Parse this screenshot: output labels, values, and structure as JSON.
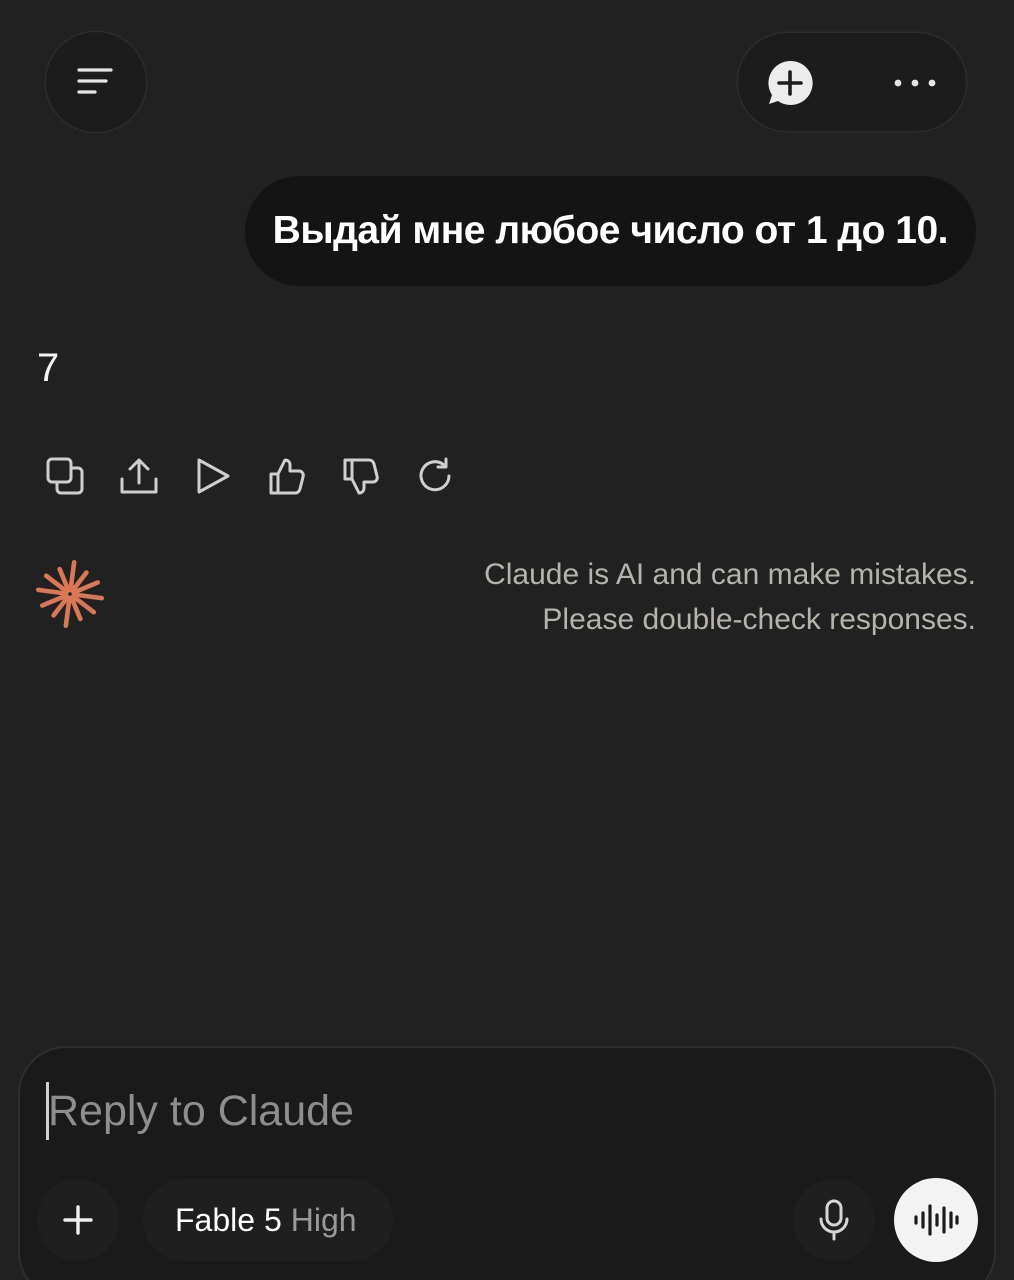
{
  "header": {
    "menu_icon": "menu-icon",
    "new_chat_icon": "new-chat-icon",
    "more_icon": "more-icon"
  },
  "conversation": {
    "user_message": "Выдай мне любое число от 1 до 10.",
    "assistant_reply": "7",
    "action_icons": [
      "copy-icon",
      "share-icon",
      "play-icon",
      "thumbs-up-icon",
      "thumbs-down-icon",
      "retry-icon"
    ]
  },
  "disclaimer": {
    "line1": "Claude is AI and can make mistakes.",
    "line2": "Please double-check responses.",
    "logo_color": "#d97757"
  },
  "composer": {
    "placeholder": "Reply to Claude",
    "value": "",
    "model_name": "Fable 5",
    "model_effort": "High",
    "add_icon": "plus-icon",
    "mic_icon": "microphone-icon",
    "voice_icon": "voice-mode-icon"
  },
  "colors": {
    "background": "#212121",
    "user_bubble": "#141414",
    "accent": "#d97757",
    "muted_text": "#b5b3ab"
  }
}
